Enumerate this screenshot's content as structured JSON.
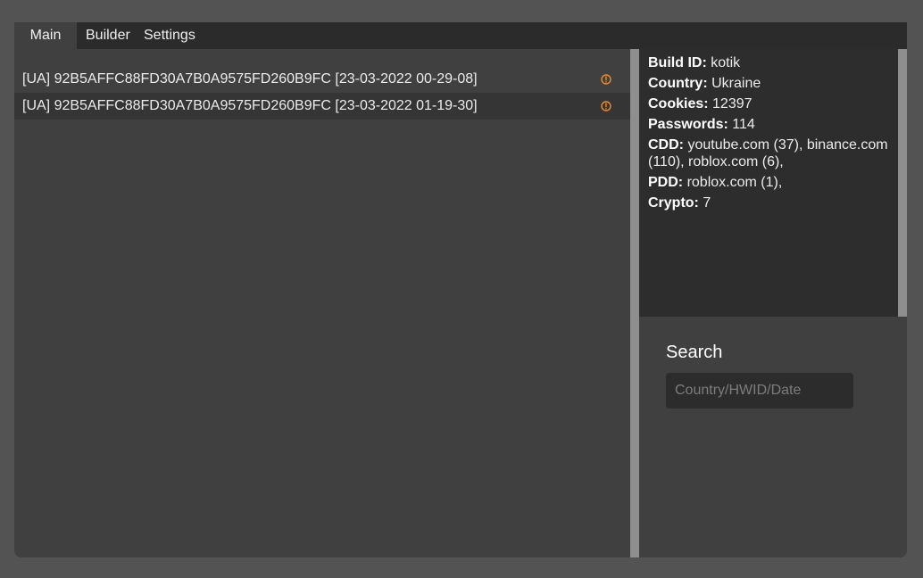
{
  "tabs": [
    {
      "label": "Main"
    },
    {
      "label": "Builder"
    },
    {
      "label": "Settings"
    }
  ],
  "logs": [
    {
      "text": "[UA] 92B5AFFC88FD30A7B0A9575FD260B9FC [23-03-2022 00-29-08]",
      "icon": "info-warning-icon"
    },
    {
      "text": "[UA] 92B5AFFC88FD30A7B0A9575FD260B9FC [23-03-2022 01-19-30]",
      "icon": "info-warning-icon"
    }
  ],
  "details": {
    "build_id": {
      "label": "Build ID:",
      "value": "kotik"
    },
    "country": {
      "label": "Country:",
      "value": "Ukraine"
    },
    "cookies": {
      "label": "Cookies:",
      "value": "12397"
    },
    "passwords": {
      "label": "Passwords:",
      "value": "114"
    },
    "cdd": {
      "label": "CDD:",
      "value": "youtube.com (37), binance.com (110), roblox.com (6),"
    },
    "pdd": {
      "label": "PDD:",
      "value": "roblox.com (1),"
    },
    "crypto": {
      "label": "Crypto:",
      "value": "7"
    }
  },
  "search": {
    "label": "Search",
    "placeholder": "Country/HWID/Date"
  },
  "colors": {
    "accent_icon": "#f08a24",
    "background": "#535353",
    "panel": "#404040",
    "info_panel": "#2d2d2d",
    "splitter": "#8e8e8e"
  }
}
